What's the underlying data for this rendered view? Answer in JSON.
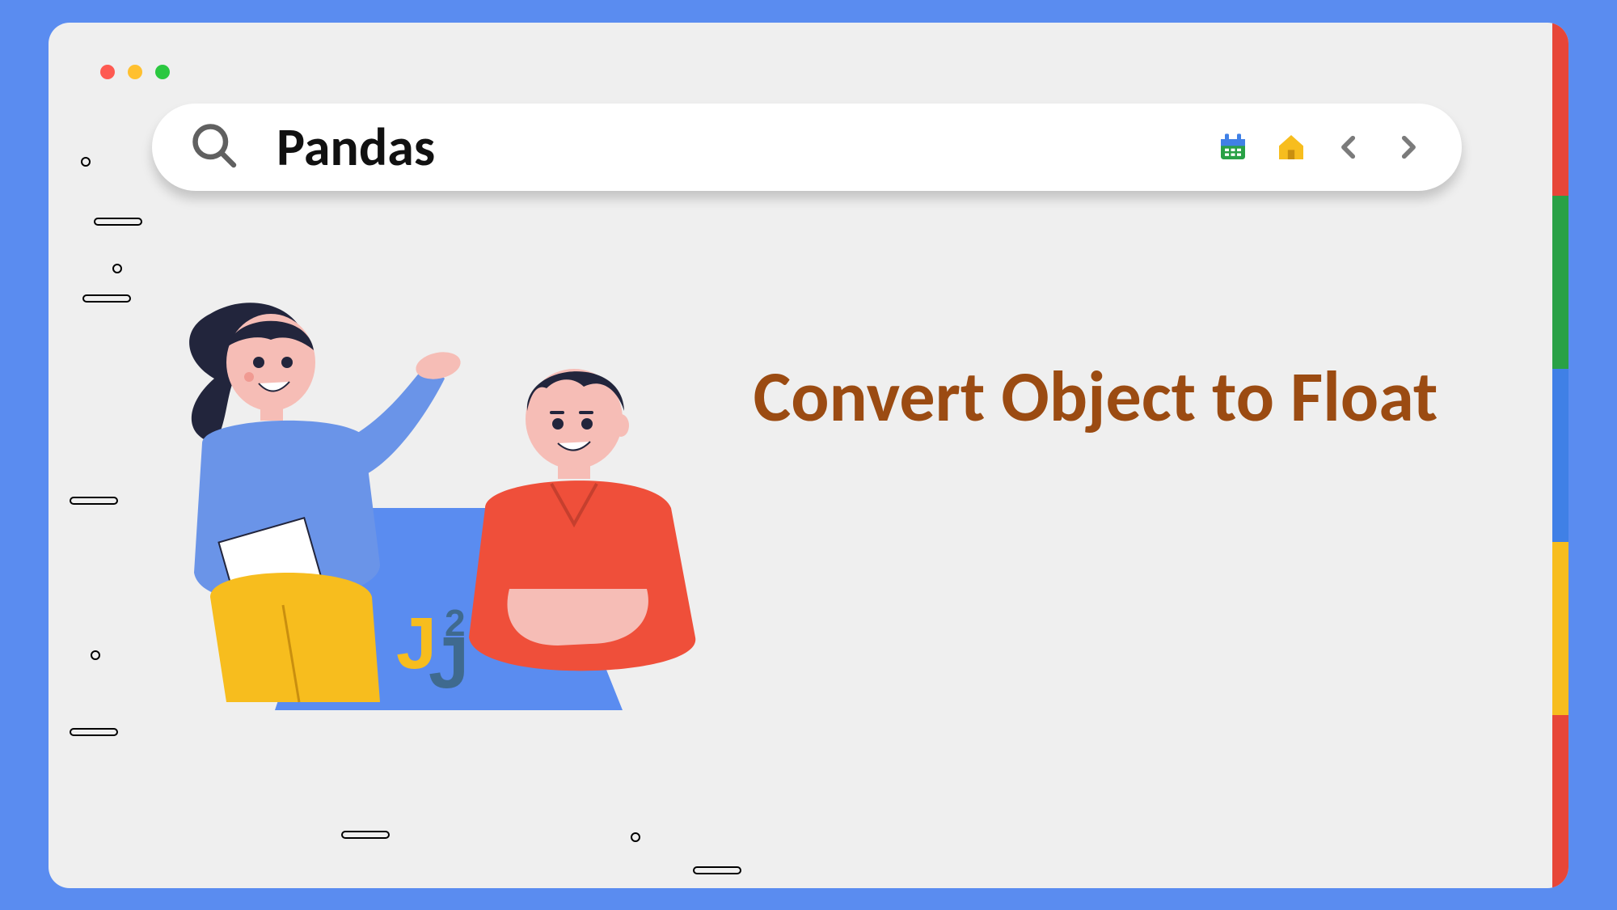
{
  "window": {
    "traffic_lights": [
      "red",
      "yellow",
      "green"
    ]
  },
  "search": {
    "query": "Pandas",
    "icons": {
      "calendar": "calendar",
      "home": "home",
      "prev": "chevron-left",
      "next": "chevron-right"
    }
  },
  "title": "Convert Object to Float",
  "logo_text": "J2",
  "side_tabs": [
    "red",
    "green",
    "blue",
    "yellow",
    "red"
  ],
  "colors": {
    "title": "#9b4b12",
    "accent_blue": "#5a8cf0",
    "icon_home": "#f7bd1e",
    "icon_calendar_top": "#4080e6",
    "icon_calendar_body": "#29a146"
  }
}
